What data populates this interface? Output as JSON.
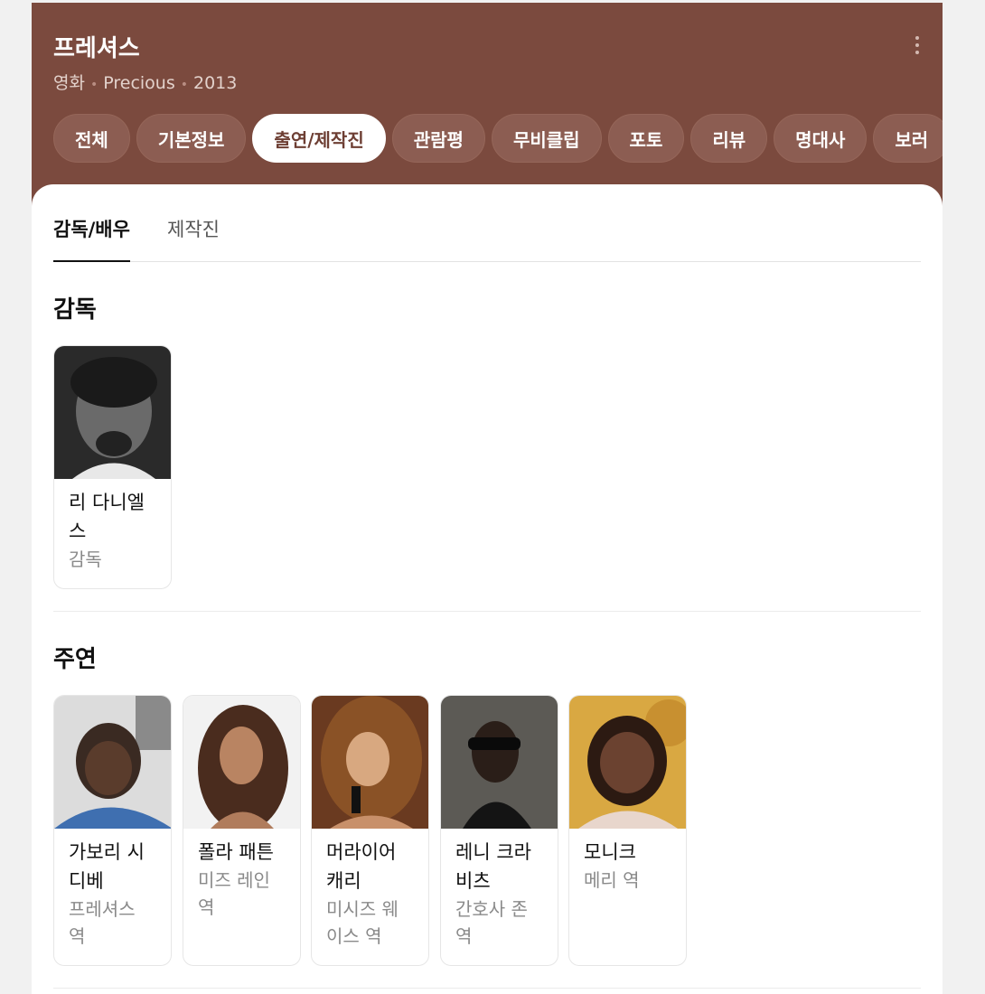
{
  "header": {
    "title": "프레셔스",
    "meta": {
      "type": "영화",
      "original_title": "Precious",
      "year": "2013"
    },
    "tabs": [
      "전체",
      "기본정보",
      "출연/제작진",
      "관람평",
      "무비클립",
      "포토",
      "리뷰",
      "명대사",
      "보러"
    ],
    "active_tab": "출연/제작진",
    "colors": {
      "header_bg": "#7b4a3e",
      "tab_bg": "#8c5d52"
    }
  },
  "subtabs": {
    "items": [
      "감독/배우",
      "제작진"
    ],
    "active": "감독/배우"
  },
  "director_section": {
    "title": "감독",
    "people": [
      {
        "name": "리 다니엘스",
        "role": "감독"
      }
    ]
  },
  "cast_section": {
    "title": "주연",
    "people": [
      {
        "name": "가보리 시디베",
        "role": "프레셔스 역"
      },
      {
        "name": "폴라 패튼",
        "role": "미즈 레인 역"
      },
      {
        "name": "머라이어 캐리",
        "role": "미시즈 웨이스 역"
      },
      {
        "name": "레니 크라비츠",
        "role": "간호사 존 역"
      },
      {
        "name": "모니크",
        "role": "메리 역"
      }
    ]
  }
}
